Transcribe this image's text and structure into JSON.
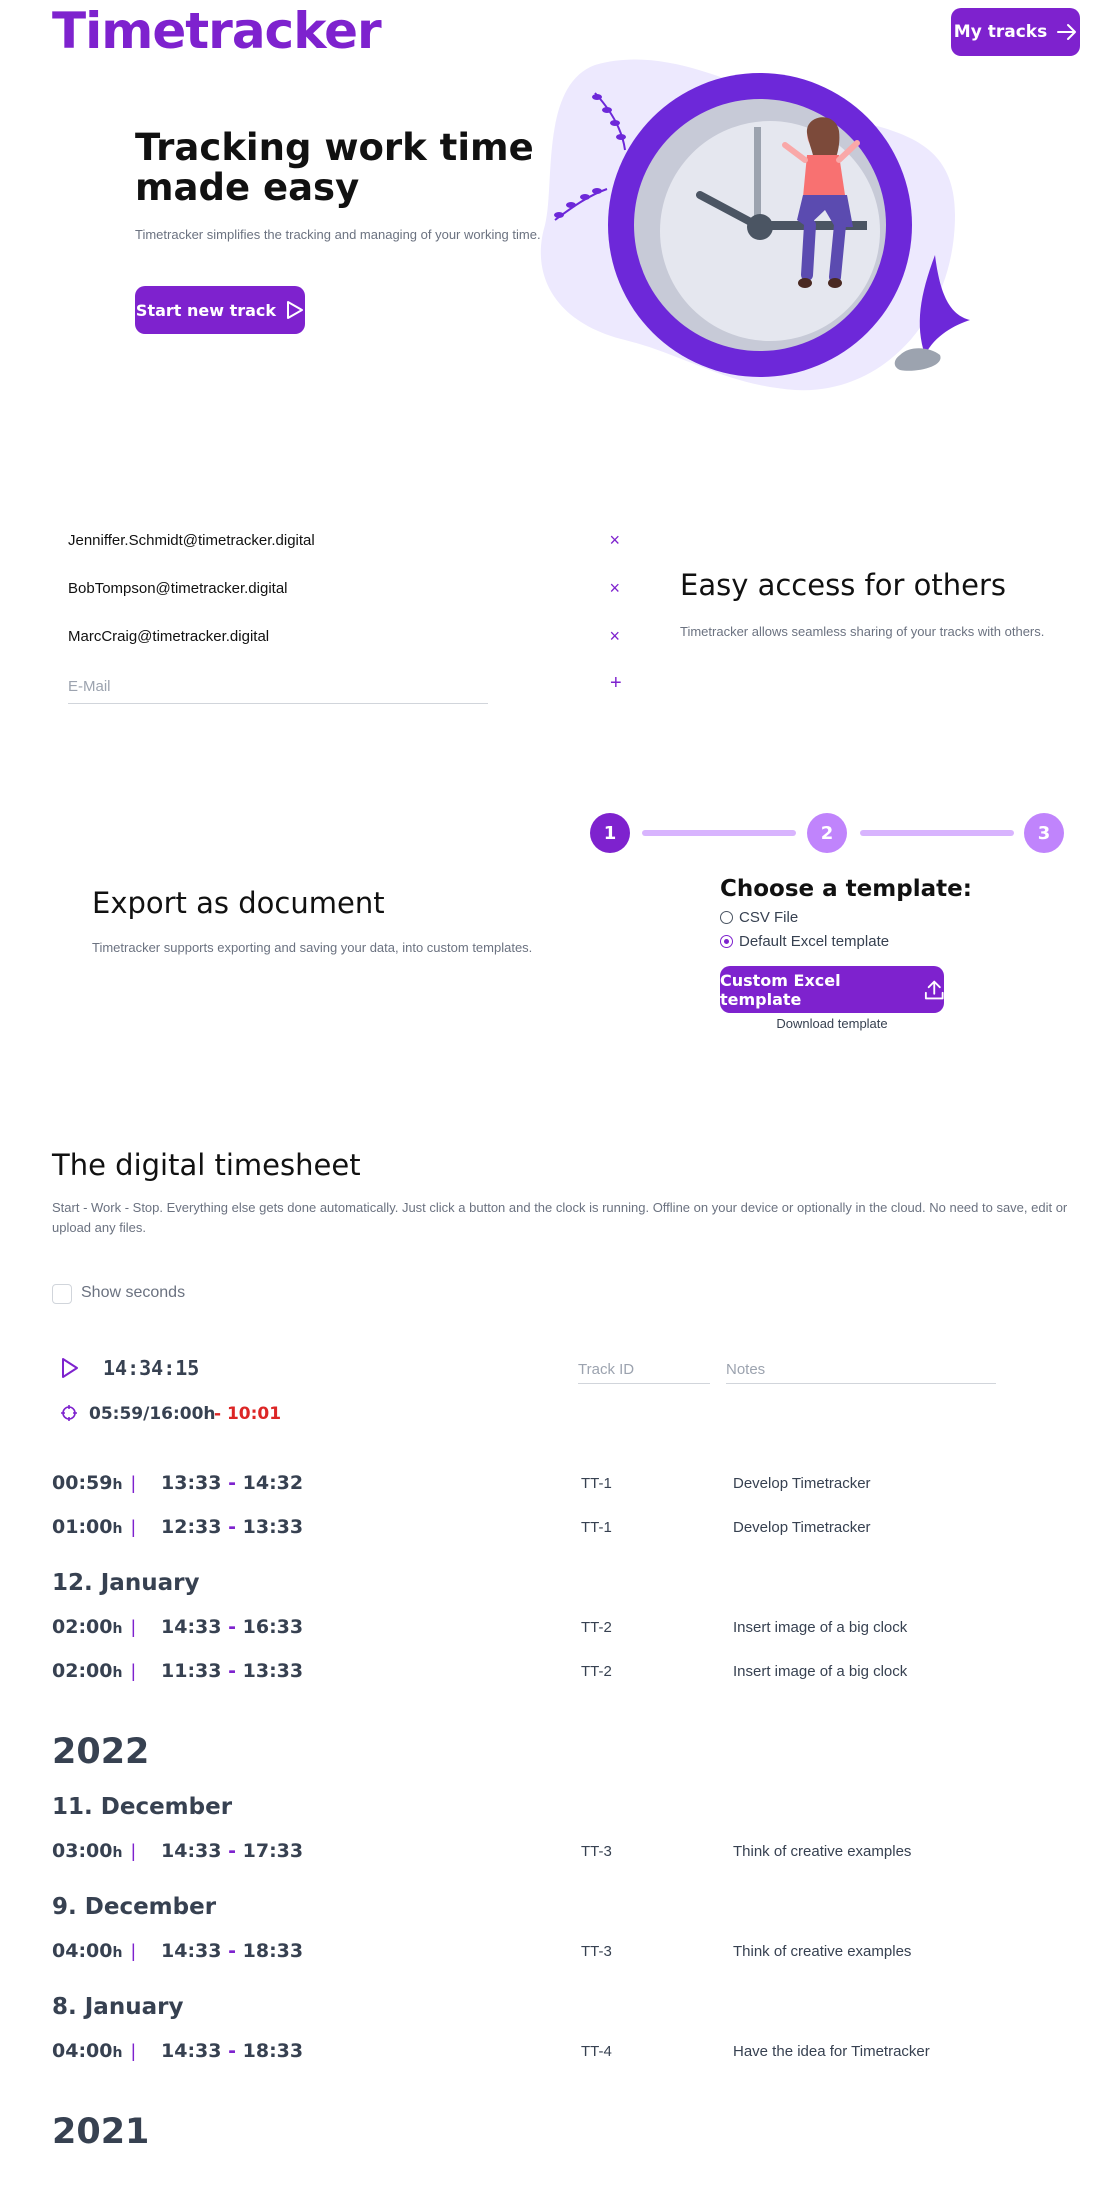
{
  "header": {
    "logo": "Timetracker",
    "my_tracks_label": "My tracks"
  },
  "hero": {
    "title": "Tracking work time made easy",
    "text": "Timetracker simplifies the tracking and managing of your working time.",
    "start_label": "Start new track"
  },
  "sharing": {
    "emails": [
      "Jenniffer.Schmidt@timetracker.digital",
      "BobTompson@timetracker.digital",
      "MarcCraig@timetracker.digital"
    ],
    "remove_symbol": "×",
    "add_symbol": "+",
    "input_placeholder": "E-Mail",
    "title": "Easy access for others",
    "text": "Timetracker allows seamless sharing of your tracks with others."
  },
  "export": {
    "title": "Export as document",
    "text": "Timetracker supports exporting and saving your data, into custom templates.",
    "steps": [
      "1",
      "2",
      "3"
    ],
    "template_title": "Choose a template:",
    "options": [
      "CSV File",
      "Default Excel template"
    ],
    "selected_option": "Default Excel template",
    "custom_label": "Custom Excel template",
    "download_label": "Download template"
  },
  "timesheet": {
    "title": "The digital timesheet",
    "text": "Start - Work - Stop. Everything else gets done automatically. Just click a button and the clock is running. Offline on your device or optionally in the cloud. No need to save, edit or upload any files.",
    "show_seconds_label": "Show seconds",
    "current_timer": "14:34:15",
    "track_id_placeholder": "Track ID",
    "notes_placeholder": "Notes",
    "goal": "05:59/16:00h",
    "over": "- 10:01",
    "entries_today": [
      {
        "duration": "00:59",
        "start": "13:33",
        "end": "14:32",
        "track_id": "TT-1",
        "note": "Develop Timetracker"
      },
      {
        "duration": "01:00",
        "start": "12:33",
        "end": "13:33",
        "track_id": "TT-1",
        "note": "Develop Timetracker"
      }
    ],
    "day_12_jan": {
      "label": "12. January",
      "entries": [
        {
          "duration": "02:00",
          "start": "14:33",
          "end": "16:33",
          "track_id": "TT-2",
          "note": "Insert image of a big clock"
        },
        {
          "duration": "02:00",
          "start": "11:33",
          "end": "13:33",
          "track_id": "TT-2",
          "note": "Insert image of a big clock"
        }
      ]
    },
    "year_2022": "2022",
    "day_11_dec": {
      "label": "11. December",
      "entries": [
        {
          "duration": "03:00",
          "start": "14:33",
          "end": "17:33",
          "track_id": "TT-3",
          "note": "Think of creative examples"
        }
      ]
    },
    "day_9_dec": {
      "label": "9. December",
      "entries": [
        {
          "duration": "04:00",
          "start": "14:33",
          "end": "18:33",
          "track_id": "TT-3",
          "note": "Think of creative examples"
        }
      ]
    },
    "day_8_jan": {
      "label": "8. January",
      "entries": [
        {
          "duration": "04:00",
          "start": "14:33",
          "end": "18:33",
          "track_id": "TT-4",
          "note": "Have the idea for Timetracker"
        }
      ]
    },
    "year_2021": "2021"
  },
  "colors": {
    "accent": "#7e22ce",
    "accent_light": "#c084fc",
    "warning": "#dc2626"
  }
}
